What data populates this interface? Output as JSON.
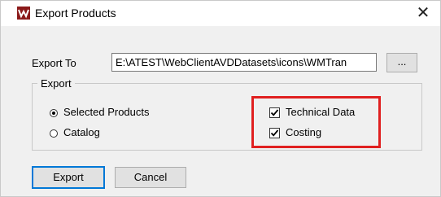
{
  "window": {
    "title": "Export Products",
    "close_glyph": "✕",
    "icon": "app-logo-icon"
  },
  "export_to": {
    "label": "Export To",
    "path_value": "E:\\ATEST\\WebClientAVDDatasets\\icons\\WMTran",
    "browse_label": "..."
  },
  "export_group": {
    "legend": "Export",
    "options": [
      {
        "label": "Selected Products",
        "selected": true
      },
      {
        "label": "Catalog",
        "selected": false
      }
    ],
    "checks": [
      {
        "label": "Technical Data",
        "checked": true
      },
      {
        "label": "Costing",
        "checked": true
      }
    ],
    "highlight_color": "#e02020"
  },
  "buttons": {
    "export_label": "Export",
    "cancel_label": "Cancel"
  },
  "colors": {
    "dialog_bg": "#f0f0f0",
    "accent": "#0078d7"
  }
}
